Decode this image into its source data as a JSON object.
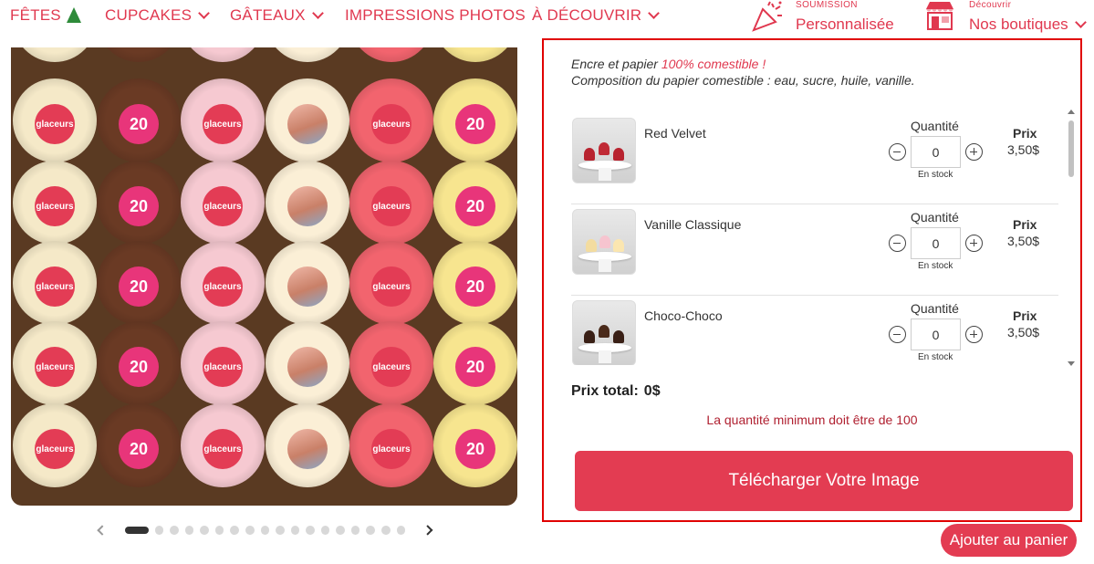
{
  "nav": {
    "items": [
      {
        "label": "FÊTES"
      },
      {
        "label": "CUPCAKES"
      },
      {
        "label": "GÂTEAUX"
      },
      {
        "label": "IMPRESSIONS PHOTOS"
      },
      {
        "label": "À DÉCOUVRIR"
      }
    ],
    "submission": {
      "small": "SOUMISSION",
      "big": "Personnalisée"
    },
    "discover": {
      "small": "Découvrir",
      "big": "Nos boutiques"
    }
  },
  "gallery": {
    "topper_logo_text": "glaceurs",
    "topper_number": "20",
    "slide_count": 18,
    "active_slide": 1
  },
  "panel": {
    "intro_line1_prefix": "Encre et papier ",
    "intro_line1_highlight": "100% comestible !",
    "intro_line2": "Composition du papier comestible : eau, sucre, huile, vanille.",
    "products": [
      {
        "name": "Red Velvet",
        "quantity_label": "Quantité",
        "quantity": "0",
        "stock": "En stock",
        "price_label": "Prix",
        "price": "3,50$"
      },
      {
        "name": "Vanille Classique",
        "quantity_label": "Quantité",
        "quantity": "0",
        "stock": "En stock",
        "price_label": "Prix",
        "price": "3,50$"
      },
      {
        "name": "Choco-Choco",
        "quantity_label": "Quantité",
        "quantity": "0",
        "stock": "En stock",
        "price_label": "Prix",
        "price": "3,50$"
      }
    ],
    "total_label": "Prix total:",
    "total_value": "0$",
    "min_message": "La quantité minimum doit être de 100",
    "upload_button": "Télécharger Votre Image"
  },
  "cart_button": "Ajouter au panier",
  "colors": {
    "accent": "#e33c52",
    "highlight_border": "#e00000"
  }
}
